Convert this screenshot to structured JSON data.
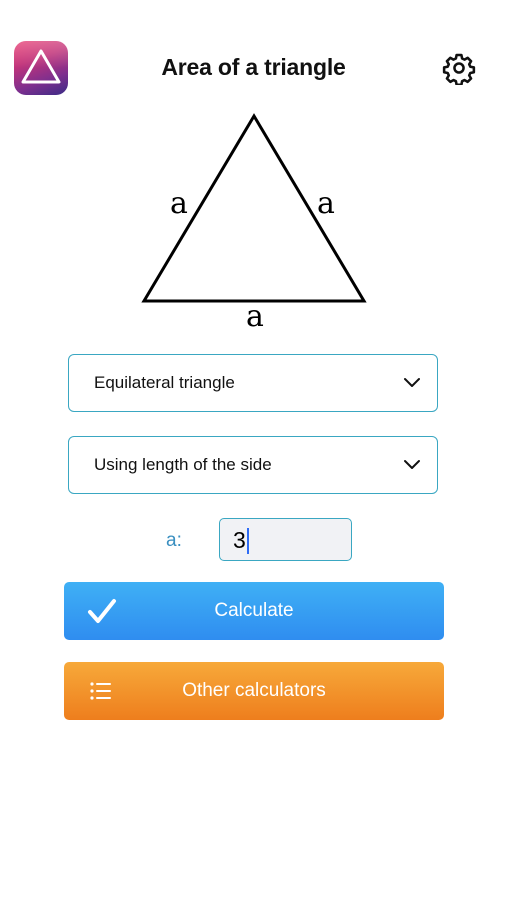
{
  "header": {
    "title": "Area of a triangle",
    "app_icon": "triangle-app-icon",
    "settings_icon": "gear-icon"
  },
  "diagram": {
    "shape": "equilateral-triangle",
    "side_labels": [
      "a",
      "a",
      "a"
    ]
  },
  "selects": {
    "triangle_type": "Equilateral triangle",
    "method": "Using length of the side"
  },
  "input": {
    "label": "a:",
    "value": "3"
  },
  "buttons": {
    "calculate_label": "Calculate",
    "other_label": "Other calculators"
  },
  "colors": {
    "accent_border": "#3aa7c2",
    "calculate_button": "#3fb0f5",
    "other_button": "#f7a93a",
    "input_label": "#3a8fc0"
  }
}
